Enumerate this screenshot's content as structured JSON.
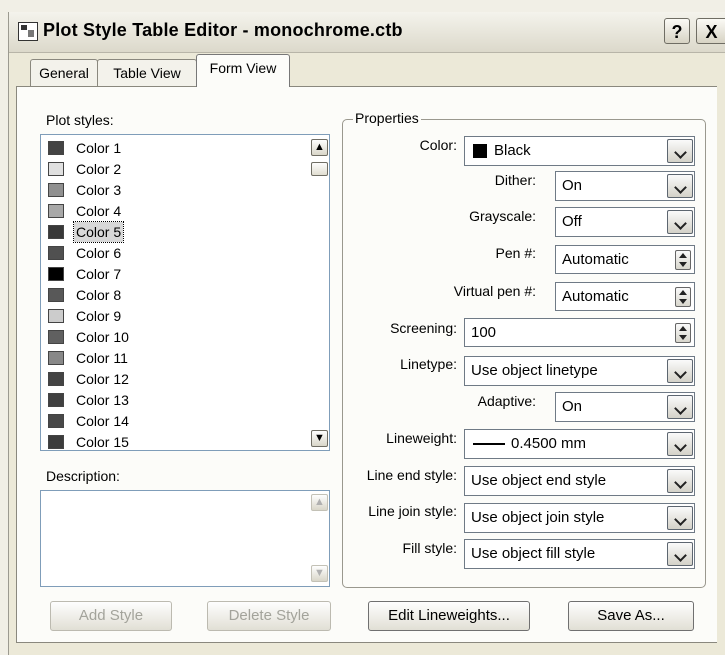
{
  "window": {
    "title": "Plot Style Table Editor - monochrome.ctb",
    "help_label": "?",
    "close_label": "X"
  },
  "tabs": [
    {
      "label": "General",
      "active": false
    },
    {
      "label": "Table View",
      "active": false
    },
    {
      "label": "Form View",
      "active": true
    }
  ],
  "plot_styles": {
    "label": "Plot styles:",
    "selected": "Color 5",
    "items": [
      {
        "label": "Color 1",
        "color": "#444444"
      },
      {
        "label": "Color 2",
        "color": "#e0e0e0"
      },
      {
        "label": "Color 3",
        "color": "#909090"
      },
      {
        "label": "Color 4",
        "color": "#a8a8a8"
      },
      {
        "label": "Color 5",
        "color": "#383838"
      },
      {
        "label": "Color 6",
        "color": "#505050"
      },
      {
        "label": "Color 7",
        "color": "#000000"
      },
      {
        "label": "Color 8",
        "color": "#585858"
      },
      {
        "label": "Color 9",
        "color": "#cccccc"
      },
      {
        "label": "Color 10",
        "color": "#606060"
      },
      {
        "label": "Color 11",
        "color": "#888888"
      },
      {
        "label": "Color 12",
        "color": "#444444"
      },
      {
        "label": "Color 13",
        "color": "#404040"
      },
      {
        "label": "Color 14",
        "color": "#484848"
      },
      {
        "label": "Color 15",
        "color": "#3c3c3c"
      }
    ]
  },
  "description": {
    "label": "Description:",
    "value": ""
  },
  "properties": {
    "group_label": "Properties",
    "color": {
      "label": "Color:",
      "value": "Black",
      "swatch": "#000000"
    },
    "dither": {
      "label": "Dither:",
      "value": "On"
    },
    "grayscale": {
      "label": "Grayscale:",
      "value": "Off"
    },
    "pen": {
      "label": "Pen #:",
      "value": "Automatic"
    },
    "virtual_pen": {
      "label": "Virtual pen #:",
      "value": "Automatic"
    },
    "screening": {
      "label": "Screening:",
      "value": "100"
    },
    "linetype": {
      "label": "Linetype:",
      "value": "Use object linetype"
    },
    "adaptive": {
      "label": "Adaptive:",
      "value": "On"
    },
    "lineweight": {
      "label": "Lineweight:",
      "value": "0.4500 mm"
    },
    "line_end_style": {
      "label": "Line end style:",
      "value": "Use object end style"
    },
    "line_join_style": {
      "label": "Line join style:",
      "value": "Use object join style"
    },
    "fill_style": {
      "label": "Fill style:",
      "value": "Use object fill style"
    }
  },
  "buttons": {
    "add_style": "Add Style",
    "delete_style": "Delete Style",
    "edit_lineweights": "Edit Lineweights...",
    "save_as": "Save As..."
  }
}
